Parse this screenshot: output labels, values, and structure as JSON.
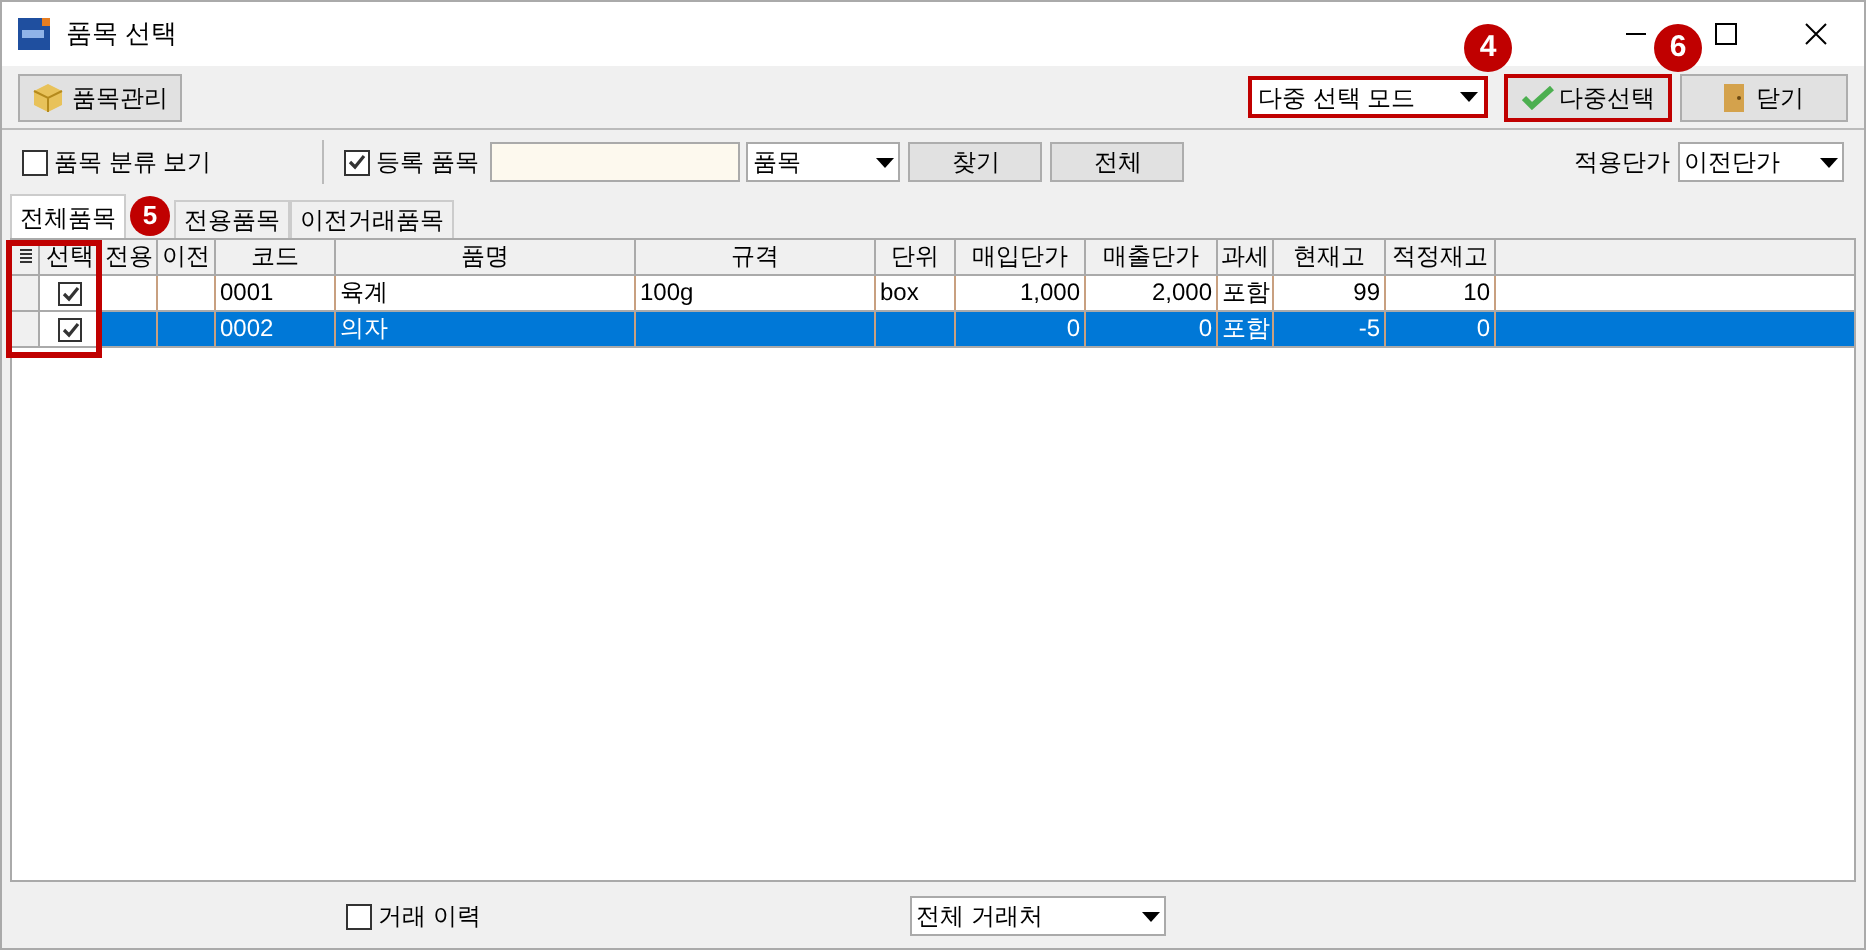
{
  "window": {
    "title": "품목 선택"
  },
  "toolbar": {
    "manage_button": {
      "label": "품목관리"
    },
    "mode_select": {
      "value": "다중 선택 모드",
      "badge": "4"
    },
    "multi_select_button": {
      "label": "다중선택",
      "badge": "6"
    },
    "close_button": {
      "label": "닫기"
    }
  },
  "filters": {
    "category_view": {
      "label": "품목 분류 보기",
      "checked": false
    },
    "registered": {
      "label": "등록 품목",
      "checked": true
    },
    "search_type": {
      "value": "품목"
    },
    "find_button": {
      "label": "찾기"
    },
    "all_button": {
      "label": "전체"
    },
    "price_label": "적용단가",
    "price_select": {
      "value": "이전단가"
    }
  },
  "tabs": [
    {
      "label": "전체품목",
      "selected": true
    },
    {
      "label": "전용품목",
      "selected": false
    },
    {
      "label": "이전거래품목",
      "selected": false
    }
  ],
  "table": {
    "badge": "5",
    "columns": [
      "선택",
      "전용",
      "이전",
      "코드",
      "품명",
      "규격",
      "단위",
      "매입단가",
      "매출단가",
      "과세",
      "현재고",
      "적정재고"
    ],
    "rows": [
      {
        "selected": false,
        "checked": true,
        "code": "0001",
        "name": "육계",
        "spec": "100g",
        "unit": "box",
        "purchase_price": "1,000",
        "sales_price": "2,000",
        "tax": "포함",
        "stock": "99",
        "proper_stock": "10"
      },
      {
        "selected": true,
        "checked": true,
        "code": "0002",
        "name": "의자",
        "purchase_price": "0",
        "sales_price": "0",
        "tax": "포함",
        "stock": "-5",
        "proper_stock": "0"
      }
    ]
  },
  "bottom": {
    "history": {
      "label": "거래 이력",
      "checked": false
    },
    "partner_select": {
      "value": "전체 거래처"
    }
  }
}
